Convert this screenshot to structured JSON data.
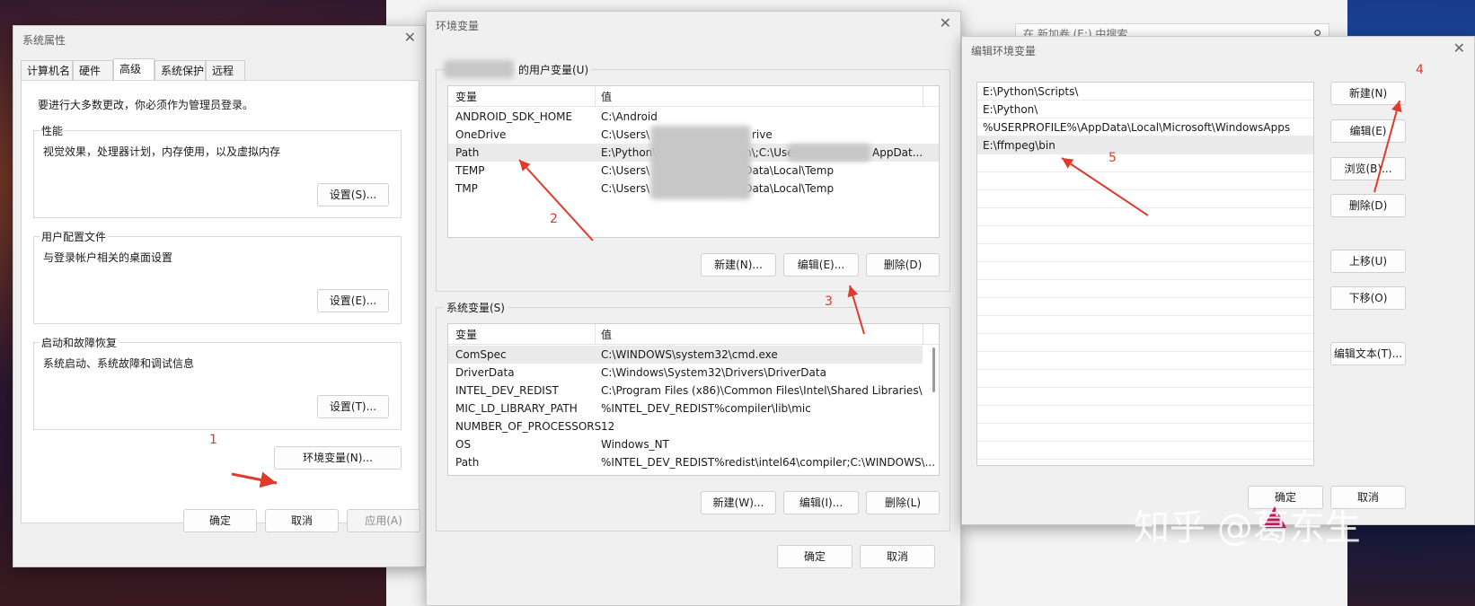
{
  "explorer": {
    "search_placeholder": "在 新加卷 (E:) 中搜索",
    "search_icon": "search-icon"
  },
  "system_properties": {
    "title": "系统属性",
    "tabs": [
      "计算机名",
      "硬件",
      "高级",
      "系统保护",
      "远程"
    ],
    "active_tab": "高级",
    "admin_note": "要进行大多数更改，你必须作为管理员登录。",
    "performance": {
      "legend": "性能",
      "desc": "视觉效果，处理器计划，内存使用，以及虚拟内存",
      "button": "设置(S)..."
    },
    "user_profiles": {
      "legend": "用户配置文件",
      "desc": "与登录帐户相关的桌面设置",
      "button": "设置(E)..."
    },
    "startup_recovery": {
      "legend": "启动和故障恢复",
      "desc": "系统启动、系统故障和调试信息",
      "button": "设置(T)..."
    },
    "env_button": "环境变量(N)...",
    "ok": "确定",
    "cancel": "取消",
    "apply": "应用(A)"
  },
  "environment_variables": {
    "title": "环境变量",
    "user_section_label": "的用户变量(U)",
    "col_var": "变量",
    "col_val": "值",
    "user_vars": [
      {
        "name": "ANDROID_SDK_HOME",
        "value": "C:\\Android"
      },
      {
        "name": "OneDrive",
        "value": "C:\\Users\\",
        "value_tail": "rive"
      },
      {
        "name": "Path",
        "value": "E:\\Python\\Scripts\\;E:\\Python\\;C:\\Users",
        "value_tail": "AppDat..."
      },
      {
        "name": "TEMP",
        "value": "C:\\Users\\",
        "value_tail": "ppData\\Local\\Temp"
      },
      {
        "name": "TMP",
        "value": "C:\\Users\\",
        "value_tail": "ppData\\Local\\Temp"
      }
    ],
    "user_buttons": {
      "new": "新建(N)...",
      "edit": "编辑(E)...",
      "delete": "删除(D)"
    },
    "system_section_label": "系统变量(S)",
    "system_vars": [
      {
        "name": "ComSpec",
        "value": "C:\\WINDOWS\\system32\\cmd.exe"
      },
      {
        "name": "DriverData",
        "value": "C:\\Windows\\System32\\Drivers\\DriverData"
      },
      {
        "name": "INTEL_DEV_REDIST",
        "value": "C:\\Program Files (x86)\\Common Files\\Intel\\Shared Libraries\\"
      },
      {
        "name": "MIC_LD_LIBRARY_PATH",
        "value": "%INTEL_DEV_REDIST%compiler\\lib\\mic"
      },
      {
        "name": "NUMBER_OF_PROCESSORS",
        "value": "12"
      },
      {
        "name": "OS",
        "value": "Windows_NT"
      },
      {
        "name": "Path",
        "value": "%INTEL_DEV_REDIST%redist\\intel64\\compiler;C:\\WINDOWS\\..."
      }
    ],
    "system_buttons": {
      "new": "新建(W)...",
      "edit": "编辑(I)...",
      "delete": "删除(L)"
    },
    "ok": "确定",
    "cancel": "取消"
  },
  "edit_env_var": {
    "title": "编辑环境变量",
    "entries": [
      "E:\\Python\\Scripts\\",
      "E:\\Python\\",
      "%USERPROFILE%\\AppData\\Local\\Microsoft\\WindowsApps",
      "E:\\ffmpeg\\bin"
    ],
    "buttons": {
      "new": "新建(N)",
      "edit": "编辑(E)",
      "browse": "浏览(B)...",
      "delete": "删除(D)",
      "move_up": "上移(U)",
      "move_down": "下移(O)",
      "edit_text": "编辑文本(T)..."
    },
    "ok": "确定",
    "cancel": "取消"
  },
  "annotations": [
    "1",
    "2",
    "3",
    "4",
    "5"
  ],
  "annotation_color": "#e03a2a",
  "watermark": "知乎 @葛东生"
}
